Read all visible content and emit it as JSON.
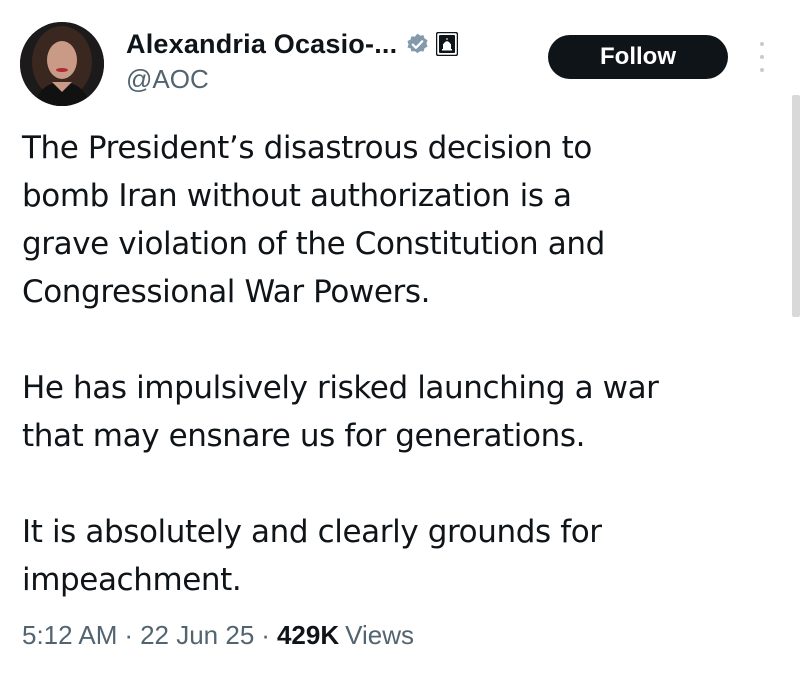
{
  "author": {
    "display_name": "Alexandria Ocasio-...",
    "handle": "@AOC",
    "avatar": "profile-photo",
    "verified_icon": "verified-badge-icon",
    "affiliation_icon": "government-capitol-icon"
  },
  "actions": {
    "follow_label": "Follow",
    "more_icon": "more-vertical-icon"
  },
  "tweet": {
    "paragraphs": [
      {
        "lines": [
          "The President’s disastrous decision to",
          "bomb Iran without authorization is a",
          "grave violation of the Constitution and",
          "Congressional War Powers."
        ]
      },
      {
        "lines": [
          "He has impulsively risked launching a war",
          "that may ensnare us for generations."
        ]
      },
      {
        "lines": [
          "It is absolutely and clearly grounds for",
          "impeachment."
        ]
      }
    ]
  },
  "meta": {
    "time": "5:12 AM",
    "separator": "·",
    "date": "22 Jun 25",
    "views_count": "429K",
    "views_label": "Views"
  },
  "colors": {
    "text_primary": "#0f1419",
    "text_secondary": "#536471",
    "follow_bg": "#0f1419",
    "follow_text": "#ffffff",
    "verified_badge": "#829aab"
  }
}
